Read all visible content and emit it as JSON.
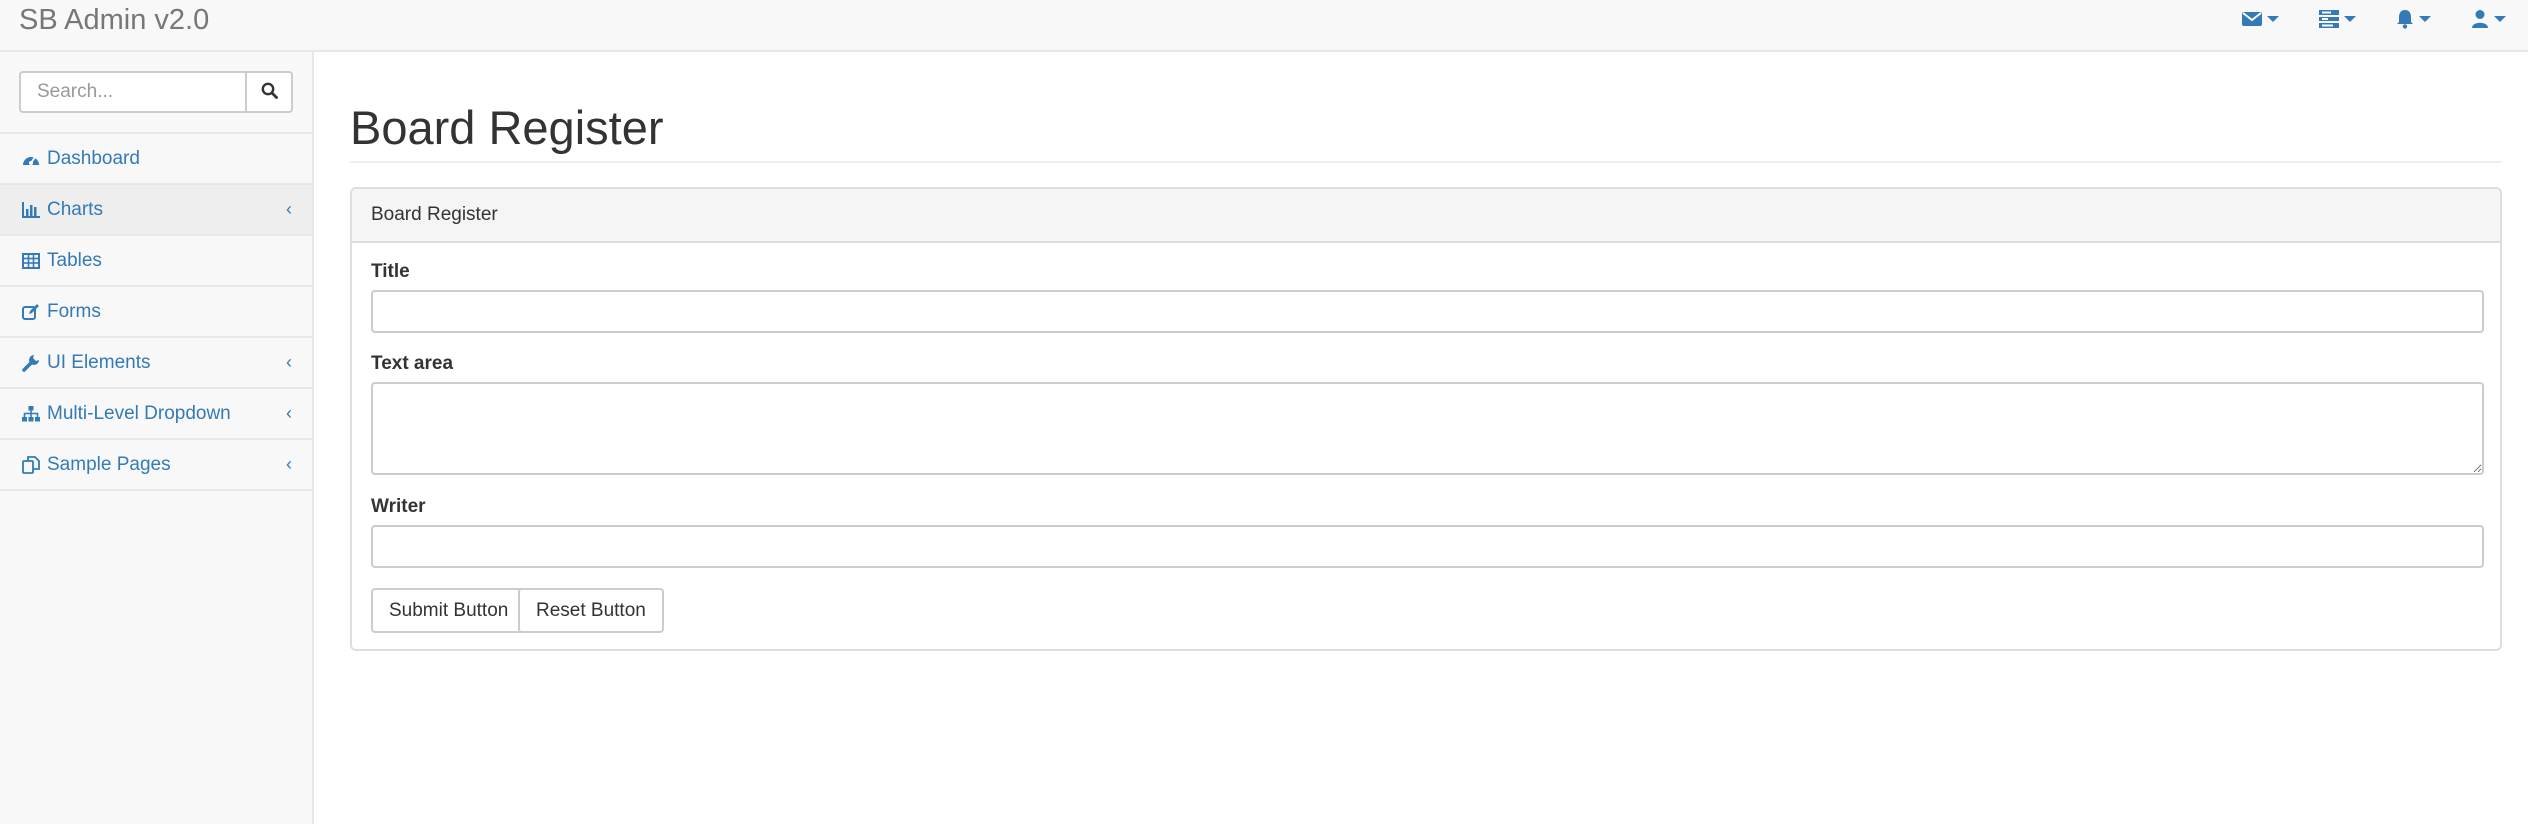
{
  "app": {
    "brand": "SB Admin v2.0"
  },
  "navbar": {
    "links": [
      {
        "icon": "envelope-icon"
      },
      {
        "icon": "tasks-icon"
      },
      {
        "icon": "bell-icon"
      },
      {
        "icon": "user-icon"
      }
    ],
    "accent_color": "#337ab7"
  },
  "sidebar": {
    "search": {
      "placeholder": "Search..."
    },
    "items": [
      {
        "label": "Dashboard",
        "icon": "dashboard-icon",
        "has_submenu": false
      },
      {
        "label": "Charts",
        "icon": "bar-chart-icon",
        "has_submenu": true,
        "active": true
      },
      {
        "label": "Tables",
        "icon": "table-icon",
        "has_submenu": false
      },
      {
        "label": "Forms",
        "icon": "edit-icon",
        "has_submenu": false
      },
      {
        "label": "UI Elements",
        "icon": "wrench-icon",
        "has_submenu": true
      },
      {
        "label": "Multi-Level Dropdown",
        "icon": "sitemap-icon",
        "has_submenu": true
      },
      {
        "label": "Sample Pages",
        "icon": "files-icon",
        "has_submenu": true
      }
    ]
  },
  "page": {
    "title": "Board Register",
    "panel": {
      "heading": "Board Register",
      "fields": {
        "title_label": "Title",
        "title_value": "",
        "textarea_label": "Text area",
        "textarea_value": "",
        "writer_label": "Writer",
        "writer_value": ""
      },
      "buttons": {
        "submit": "Submit Button",
        "reset": "Reset Button"
      }
    }
  }
}
